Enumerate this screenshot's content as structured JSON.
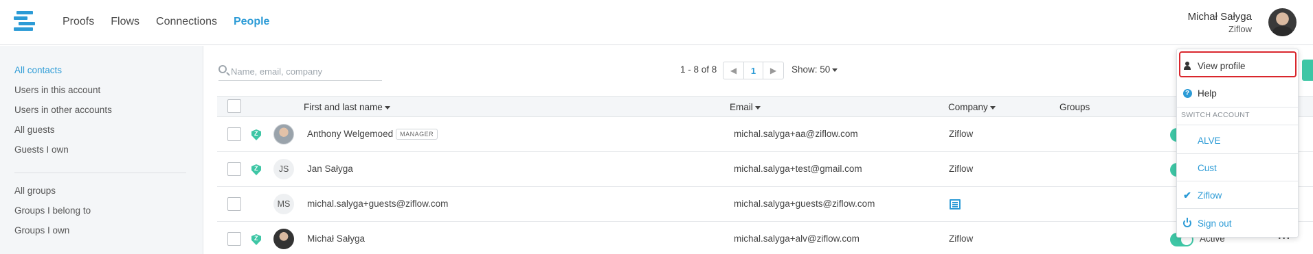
{
  "nav": {
    "items": [
      {
        "label": "Proofs",
        "active": false
      },
      {
        "label": "Flows",
        "active": false
      },
      {
        "label": "Connections",
        "active": false
      },
      {
        "label": "People",
        "active": true
      }
    ]
  },
  "user": {
    "name": "Michał Sałyga",
    "org": "Ziflow"
  },
  "sidebar": {
    "contacts": [
      "All contacts",
      "Users in this account",
      "Users in other accounts",
      "All guests",
      "Guests I own"
    ],
    "groups": [
      "All groups",
      "Groups I belong to",
      "Groups I own"
    ]
  },
  "toolbar": {
    "search_placeholder": "Name, email, company",
    "range": "1 - 8 of 8",
    "page": "1",
    "show": "Show: 50"
  },
  "table": {
    "headers": {
      "name": "First and last name",
      "email": "Email",
      "company": "Company",
      "groups": "Groups"
    },
    "rows": [
      {
        "name": "Anthony Welgemoed",
        "badge": "MANAGER",
        "email": "michal.salyga+aa@ziflow.com",
        "company": "Ziflow"
      },
      {
        "name": "Jan Sałyga",
        "initials": "JS",
        "email": "michal.salyga+test@gmail.com",
        "company": "Ziflow"
      },
      {
        "name": "michal.salyga+guests@ziflow.com",
        "initials": "MS",
        "email": "michal.salyga+guests@ziflow.com",
        "company": ""
      },
      {
        "name": "Michał Sałyga",
        "email": "michal.salyga+alv@ziflow.com",
        "company": "Ziflow",
        "status": "Active"
      }
    ]
  },
  "dropdown": {
    "view_profile": "View profile",
    "help": "Help",
    "switch_header": "SWITCH ACCOUNT",
    "accounts": [
      "ALVE",
      "Cust",
      "Ziflow"
    ],
    "sign_out": "Sign out"
  },
  "colors": {
    "accent": "#2c9bd6",
    "green": "#3ec6a5",
    "highlight": "#d9262c"
  }
}
